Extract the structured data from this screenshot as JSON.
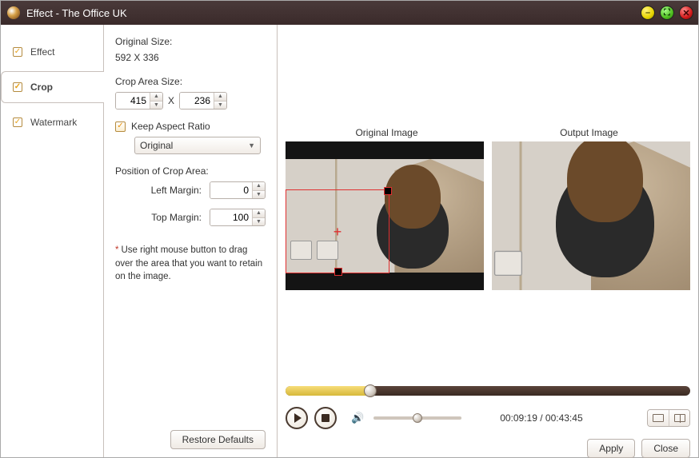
{
  "window": {
    "title": "Effect - The Office UK"
  },
  "tabs": {
    "items": [
      {
        "id": "effect",
        "label": "Effect"
      },
      {
        "id": "crop",
        "label": "Crop"
      },
      {
        "id": "watermark",
        "label": "Watermark"
      }
    ],
    "selected": "crop"
  },
  "crop": {
    "original_size_label": "Original Size:",
    "original_size_value": "592 X 336",
    "crop_area_label": "Crop Area Size:",
    "width": "415",
    "x_sep": "X",
    "height": "236",
    "keep_ratio_label": "Keep Aspect Ratio",
    "keep_ratio_checked": true,
    "ratio_select": "Original",
    "position_label": "Position of Crop Area:",
    "left_margin_label": "Left Margin:",
    "left_margin_value": "0",
    "top_margin_label": "Top Margin:",
    "top_margin_value": "100",
    "hint": "Use right mouse button to drag over the area that you want to retain on the image.",
    "restore_defaults": "Restore Defaults"
  },
  "preview": {
    "original_label": "Original Image",
    "output_label": "Output Image",
    "played_pct": 21,
    "volume_pct": 50,
    "time": "00:09:19 / 00:43:45"
  },
  "footer": {
    "apply": "Apply",
    "close": "Close"
  }
}
